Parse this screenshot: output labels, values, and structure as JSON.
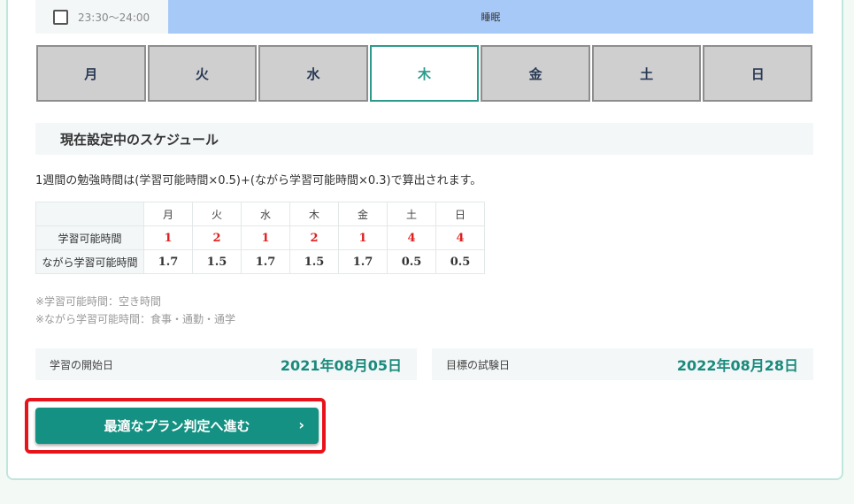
{
  "slot": {
    "time": "23:30〜24:00",
    "activity": "睡眠"
  },
  "tabs": [
    "月",
    "火",
    "水",
    "木",
    "金",
    "土",
    "日"
  ],
  "active_tab": "木",
  "section": {
    "title": "現在設定中のスケジュール",
    "description": "1週間の勉強時間は(学習可能時間×0.5)+(ながら学習可能時間×0.3)で算出されます。"
  },
  "schedule": {
    "days": [
      "月",
      "火",
      "水",
      "木",
      "金",
      "土",
      "日"
    ],
    "rows": [
      {
        "label": "学習可能時間",
        "values": [
          "1",
          "2",
          "1",
          "2",
          "1",
          "4",
          "4"
        ]
      },
      {
        "label": "ながら学習可能時間",
        "values": [
          "1.7",
          "1.5",
          "1.7",
          "1.5",
          "1.7",
          "0.5",
          "0.5"
        ]
      }
    ]
  },
  "notes": [
    "※学習可能時間：空き時間",
    "※ながら学習可能時間：食事・通勤・通学"
  ],
  "dates": {
    "start_label": "学習の開始日",
    "start_value": "2021年08月05日",
    "exam_label": "目標の試験日",
    "exam_value": "2022年08月28日"
  },
  "cta": {
    "label": "最適なプラン判定へ進む",
    "chevron": "›"
  },
  "colors": {
    "accent": "#149182",
    "highlight": "#e8121a",
    "slot_bar": "#a7c9f8"
  }
}
